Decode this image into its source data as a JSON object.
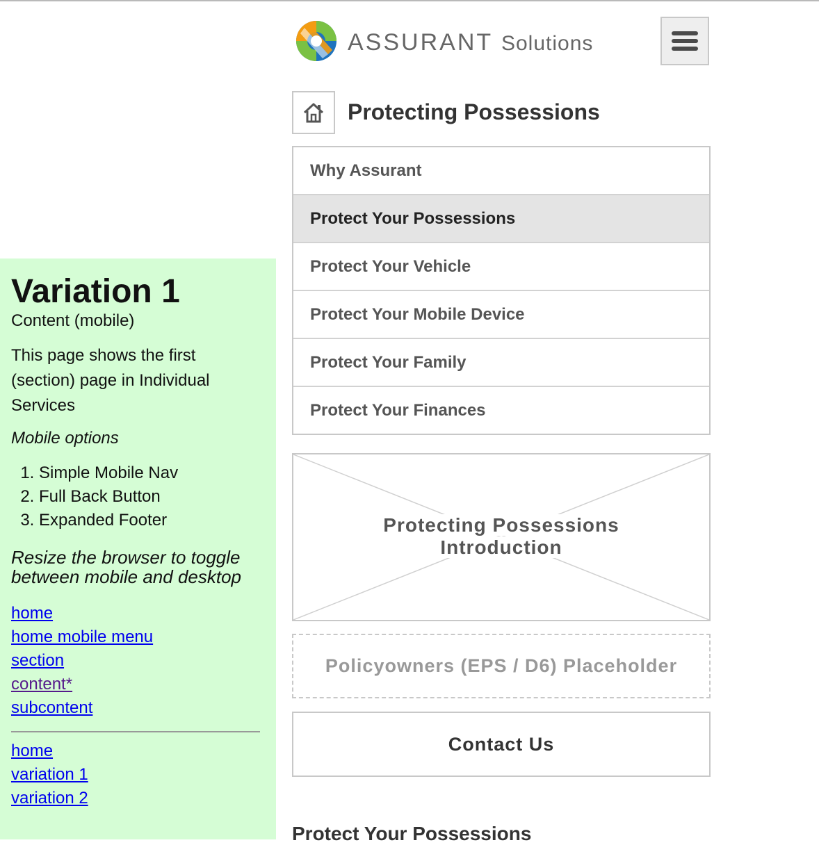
{
  "panel": {
    "title": "Variation 1",
    "subtitle": "Content (mobile)",
    "description": "This page shows the first (section) page in Individual Services",
    "options_heading": "Mobile options",
    "options": [
      "Simple Mobile Nav",
      "Full Back Button",
      "Expanded Footer"
    ],
    "resize_note": "Resize the browser to toggle between mobile and desktop",
    "links_primary": [
      "home",
      "home mobile menu",
      "section",
      "content*",
      "subcontent"
    ],
    "links_secondary": [
      "home",
      "variation 1",
      "variation 2"
    ]
  },
  "header": {
    "logo_word": "ASSURANT",
    "logo_sub": "Solutions",
    "brand_colors": {
      "blue": "#1e73be",
      "orange": "#f39c12",
      "green": "#7ac143"
    },
    "menu_icon": "hamburger-icon"
  },
  "page": {
    "home_icon": "home-icon",
    "title": "Protecting Possessions"
  },
  "nav": {
    "items": [
      "Why Assurant",
      "Protect Your Possessions",
      "Protect Your Vehicle",
      "Protect Your Mobile Device",
      "Protect Your Family",
      "Protect Your Finances"
    ],
    "active_index": 1
  },
  "intro_placeholder": {
    "line1": "Protecting Possessions",
    "line2": "Introduction"
  },
  "policy_placeholder": "Policyowners (EPS / D6) Placeholder",
  "contact_label": "Contact Us",
  "section_heading": "Protect Your Possessions"
}
